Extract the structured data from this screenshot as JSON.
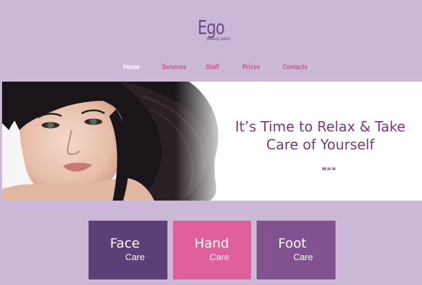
{
  "brand": {
    "name": "Ego",
    "tagline": "beauty salon"
  },
  "nav": [
    {
      "label": "Home",
      "active": true
    },
    {
      "label": "Services",
      "active": false
    },
    {
      "label": "Staff",
      "active": false
    },
    {
      "label": "Prices",
      "active": false
    },
    {
      "label": "Contacts",
      "active": false
    }
  ],
  "hero": {
    "heading_line1": "It’s Time to Relax & Take",
    "heading_line2": "Care of Yourself",
    "slides": 3,
    "active_slide": 1
  },
  "cards": [
    {
      "title": "Face",
      "subtitle": "Care",
      "color": "#5d3f78"
    },
    {
      "title": "Hand",
      "subtitle": "Care",
      "color": "#e0609b"
    },
    {
      "title": "Foot",
      "subtitle": "Care",
      "color": "#825290"
    }
  ],
  "colors": {
    "background": "#cbb8d7",
    "accent_pink": "#d9508e",
    "brand_purple": "#6a4a86"
  }
}
